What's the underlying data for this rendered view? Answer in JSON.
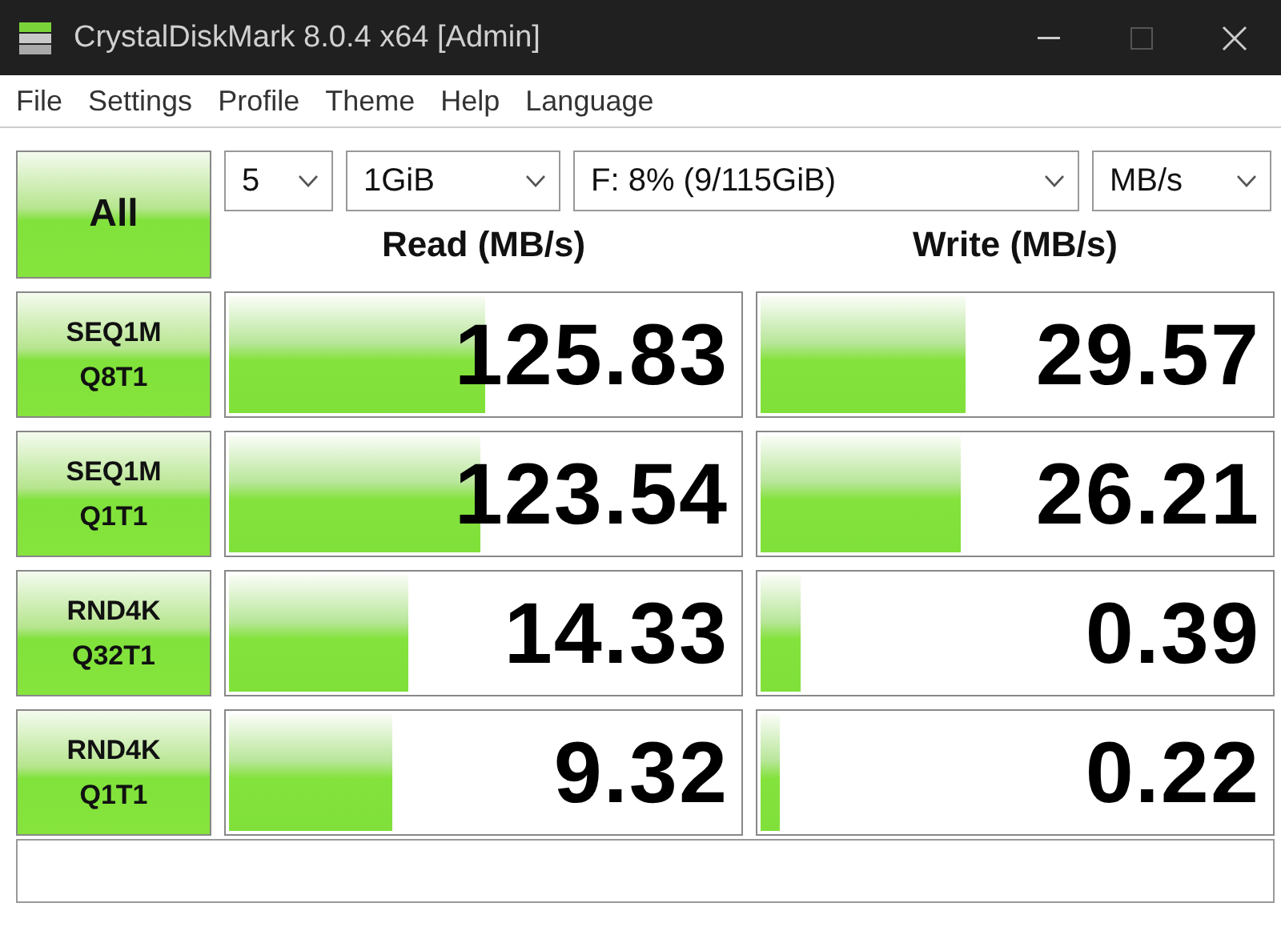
{
  "window": {
    "title": "CrystalDiskMark 8.0.4 x64 [Admin]"
  },
  "menu": [
    "File",
    "Settings",
    "Profile",
    "Theme",
    "Help",
    "Language"
  ],
  "all_button": "All",
  "selects": [
    {
      "kind": "count",
      "value": "5"
    },
    {
      "kind": "size",
      "value": "1GiB"
    },
    {
      "kind": "drive",
      "value": "F: 8% (9/115GiB)"
    },
    {
      "kind": "unit",
      "value": "MB/s"
    }
  ],
  "headers": {
    "read": "Read (MB/s)",
    "write": "Write (MB/s)"
  },
  "tests": [
    {
      "line1": "SEQ1M",
      "line2": "Q8T1",
      "read": {
        "value": "125.83",
        "level": 0.51
      },
      "write": {
        "value": "29.57",
        "level": 0.41
      }
    },
    {
      "line1": "SEQ1M",
      "line2": "Q1T1",
      "read": {
        "value": "123.54",
        "level": 0.5
      },
      "write": {
        "value": "26.21",
        "level": 0.4
      }
    },
    {
      "line1": "RND4K",
      "line2": "Q32T1",
      "read": {
        "value": "14.33",
        "level": 0.36
      },
      "write": {
        "value": "0.39",
        "level": 0.09
      }
    },
    {
      "line1": "RND4K",
      "line2": "Q1T1",
      "read": {
        "value": "9.32",
        "level": 0.33
      },
      "write": {
        "value": "0.22",
        "level": 0.05
      }
    }
  ]
}
